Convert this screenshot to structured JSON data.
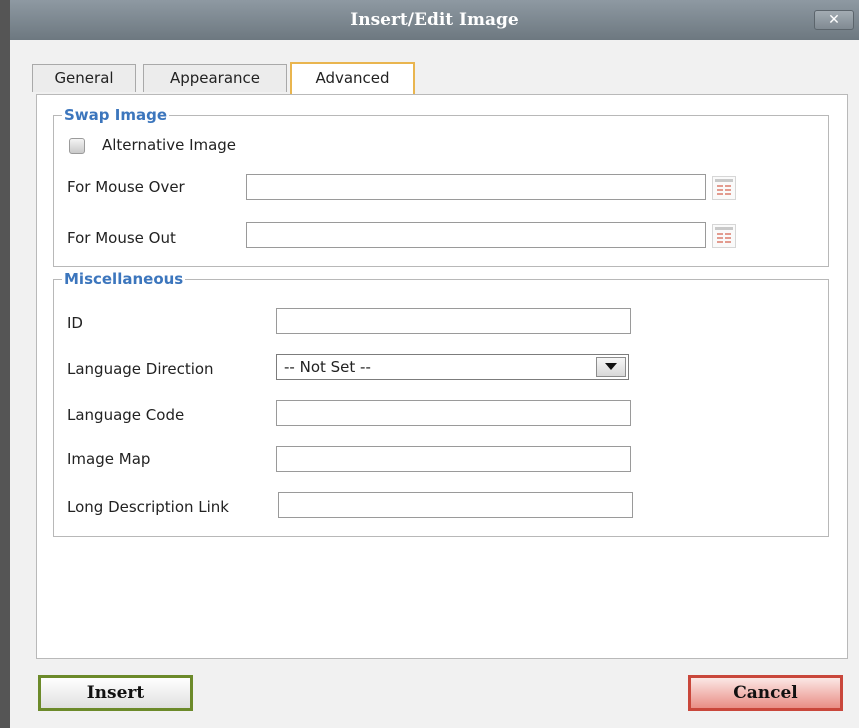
{
  "window": {
    "title": "Insert/Edit Image",
    "close_glyph": "✕"
  },
  "tabs": [
    {
      "label": "General"
    },
    {
      "label": "Appearance"
    },
    {
      "label": "Advanced"
    }
  ],
  "active_tab": "Advanced",
  "swap_image": {
    "legend": "Swap Image",
    "alternative_image_label": "Alternative Image",
    "alternative_image_checked": false,
    "mouse_over_label": "For Mouse Over",
    "mouse_over_value": "",
    "mouse_out_label": "For Mouse Out",
    "mouse_out_value": ""
  },
  "misc": {
    "legend": "Miscellaneous",
    "id_label": "ID",
    "id_value": "",
    "direction_label": "Language Direction",
    "direction_value": "-- Not Set --",
    "lang_code_label": "Language Code",
    "lang_code_value": "",
    "image_map_label": "Image Map",
    "image_map_value": "",
    "long_desc_label": "Long Description Link",
    "long_desc_value": ""
  },
  "buttons": {
    "insert": "Insert",
    "cancel": "Cancel"
  },
  "icons": {
    "picker": "browse-list-icon",
    "dropdown": "dropdown-arrow-icon"
  },
  "colors": {
    "titlebar": "#7a858e",
    "legend_text": "#3c76bd",
    "active_tab_border": "#e9b54f",
    "insert_border": "#6c8a2a",
    "cancel_border": "#c9473b"
  }
}
